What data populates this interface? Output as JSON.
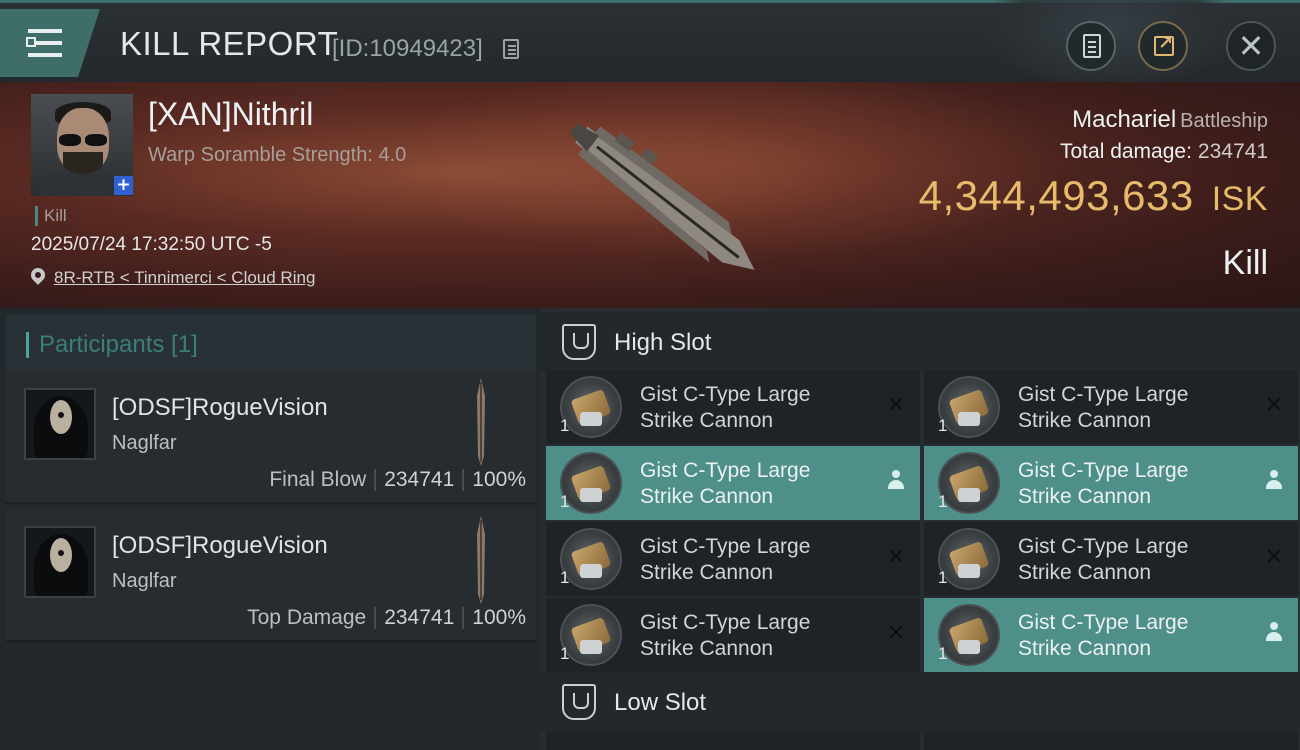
{
  "header": {
    "title": "KILL REPORT",
    "report_id": "[ID:10949423]"
  },
  "victim": {
    "name": "[XAN]Nithril",
    "subtitle": "Warp Soramble Strength: 4.0",
    "kill_tag": "Kill",
    "timestamp": "2025/07/24 17:32:50 UTC -5",
    "location": "8R-RTB < Tinnimerci < Cloud Ring",
    "ship_name": "Machariel",
    "ship_class": "Battleship",
    "total_damage_label": "Total damage:",
    "total_damage": "234741",
    "isk_value": "4,344,493,633",
    "isk_unit": "ISK",
    "result": "Kill"
  },
  "participants": {
    "title": "Participants [1]",
    "rows": [
      {
        "name": "[ODSF]RogueVision",
        "ship": "Naglfar",
        "role": "Final Blow",
        "damage": "234741",
        "percent": "100%"
      },
      {
        "name": "[ODSF]RogueVision",
        "ship": "Naglfar",
        "role": "Top Damage",
        "damage": "234741",
        "percent": "100%"
      }
    ]
  },
  "slots": {
    "high_title": "High Slot",
    "low_title": "Low Slot",
    "high_modules": [
      {
        "name_line1": "Gist C-Type Large",
        "name_line2": "Strike Cannon",
        "qty": "1",
        "status": "destroyed"
      },
      {
        "name_line1": "Gist C-Type Large",
        "name_line2": "Strike Cannon",
        "qty": "1",
        "status": "destroyed"
      },
      {
        "name_line1": "Gist C-Type Large",
        "name_line2": "Strike Cannon",
        "qty": "1",
        "status": "dropped"
      },
      {
        "name_line1": "Gist C-Type Large",
        "name_line2": "Strike Cannon",
        "qty": "1",
        "status": "dropped"
      },
      {
        "name_line1": "Gist C-Type Large",
        "name_line2": "Strike Cannon",
        "qty": "1",
        "status": "destroyed"
      },
      {
        "name_line1": "Gist C-Type Large",
        "name_line2": "Strike Cannon",
        "qty": "1",
        "status": "destroyed"
      },
      {
        "name_line1": "Gist C-Type Large",
        "name_line2": "Strike Cannon",
        "qty": "1",
        "status": "destroyed"
      },
      {
        "name_line1": "Gist C-Type Large",
        "name_line2": "Strike Cannon",
        "qty": "1",
        "status": "dropped"
      }
    ]
  },
  "colors": {
    "accent_teal": "#4f8f89",
    "isk_gold": "#e7bb6a",
    "banner_red": "#5a2a22"
  }
}
